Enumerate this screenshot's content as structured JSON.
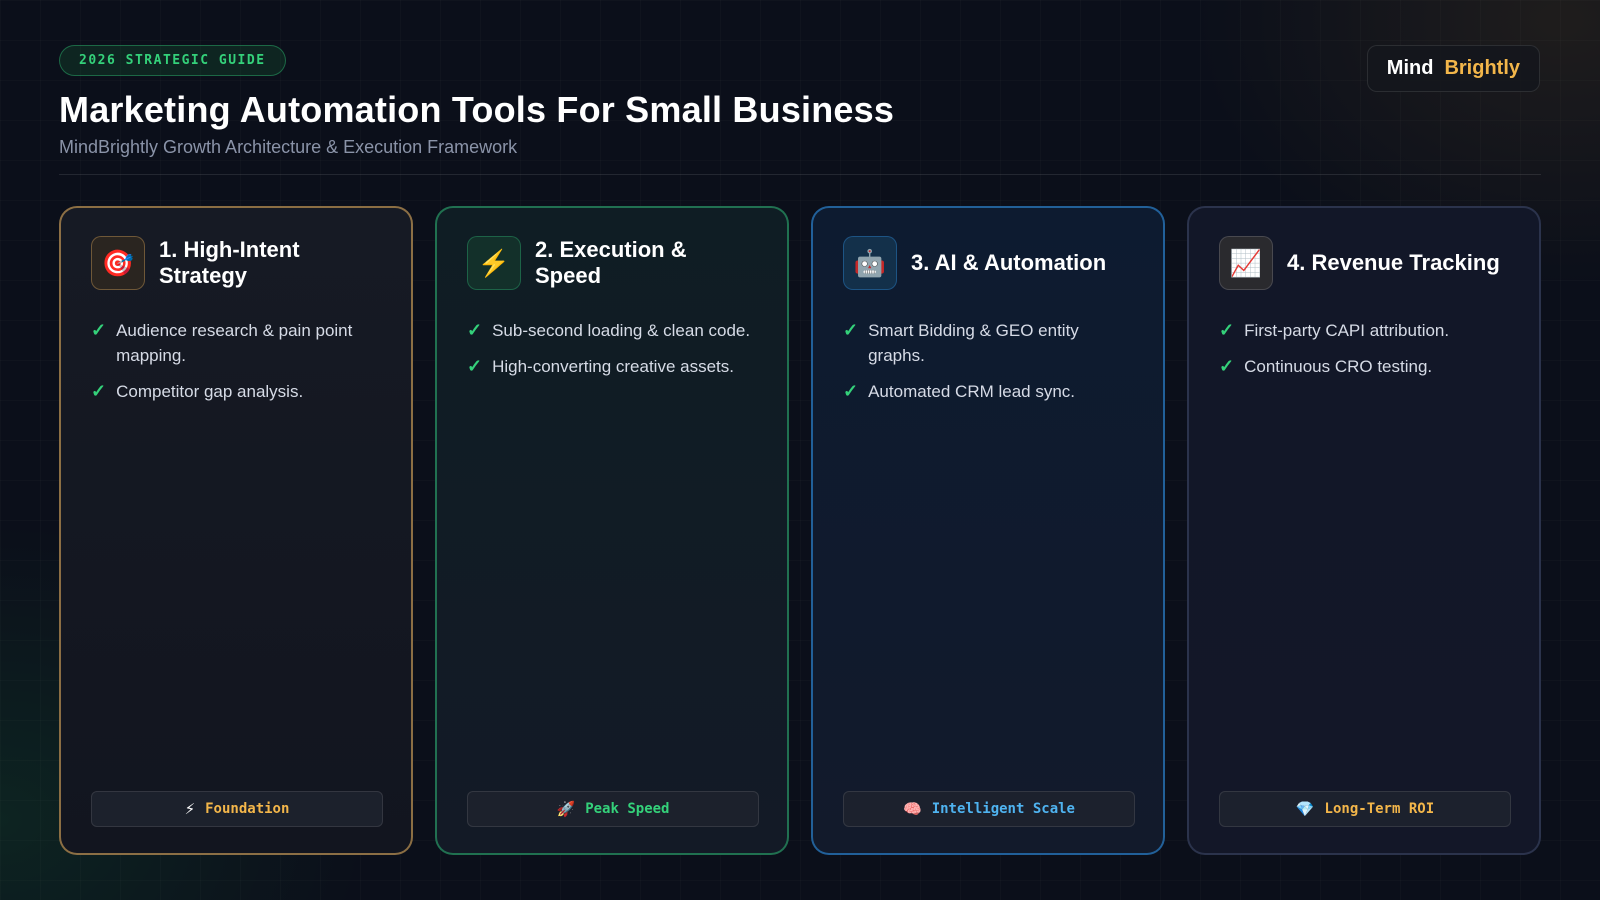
{
  "header": {
    "badge": "2026 STRATEGIC GUIDE",
    "title": "Marketing Automation Tools For Small Business",
    "subtitle": "MindBrightly Growth Architecture & Execution Framework"
  },
  "logo": {
    "word1": "Mind",
    "word2": "Brightly"
  },
  "colors": {
    "background": "#0b0f1a",
    "check_green": "#34d17a",
    "logo_gold": "#f3b64a",
    "tag_gold": "#f3b64a",
    "tag_green": "#34d17a",
    "tag_blue": "#4fb3f0",
    "tag_amber": "#f3b64a"
  },
  "cards": [
    {
      "icon": "target-icon",
      "icon_glyph": "🎯",
      "title": "1. High-Intent Strategy",
      "items": [
        "Audience research & pain point mapping.",
        "Competitor gap analysis."
      ],
      "tag_icon": "lightning-icon",
      "tag_glyph": "⚡",
      "tag": "Foundation",
      "tag_color": "#f3b64a"
    },
    {
      "icon": "lightning-icon",
      "icon_glyph": "⚡",
      "title": "2. Execution & Speed",
      "items": [
        "Sub-second loading & clean code.",
        "High-converting creative assets."
      ],
      "tag_icon": "rocket-icon",
      "tag_glyph": "🚀",
      "tag": "Peak Speed",
      "tag_color": "#34d17a"
    },
    {
      "icon": "robot-icon",
      "icon_glyph": "🤖",
      "title": "3. AI & Automation",
      "items": [
        "Smart Bidding & GEO entity graphs.",
        "Automated CRM lead sync."
      ],
      "tag_icon": "brain-icon",
      "tag_glyph": "🧠",
      "tag": "Intelligent Scale",
      "tag_color": "#4fb3f0"
    },
    {
      "icon": "chart-up-icon",
      "icon_glyph": "📈",
      "title": "4. Revenue Tracking",
      "items": [
        "First-party CAPI attribution.",
        "Continuous CRO testing."
      ],
      "tag_icon": "gem-icon",
      "tag_glyph": "💎",
      "tag": "Long-Term ROI",
      "tag_color": "#f3b64a"
    }
  ]
}
